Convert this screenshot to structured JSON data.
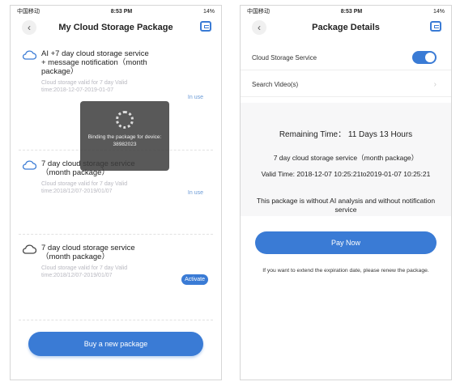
{
  "status_bar": {
    "carrier": "中国移动",
    "time": "8:53 PM",
    "battery": "14%"
  },
  "left": {
    "title": "My Cloud Storage Package",
    "packages": [
      {
        "title": "AI +7 day cloud storage service + message notification（month package）",
        "sub": "Cloud storage valid for 7 day Valid time:2018-12-07-2019-01-07",
        "status": "In use"
      },
      {
        "title": "7 day cloud storage service（month package）",
        "sub": "Cloud storage valid for 7 day Valid time:2018/12/07-2019/01/07",
        "status": "In use"
      },
      {
        "title": "7 day cloud storage service（month package）",
        "sub": "Cloud storage valid for 7 day Valid time:2018/12/07-2019/01/07",
        "status": "Activate"
      }
    ],
    "toast": "Binding the package for device: 38982023",
    "buy_button": "Buy a new package"
  },
  "right": {
    "title": "Package Details",
    "cloud_storage_service": "Cloud Storage Service",
    "cloud_storage_on": true,
    "search_videos": "Search Video(s)",
    "remaining_label": "Remaining Time：",
    "remaining_value": "11 Days 13 Hours",
    "package_name": "7 day cloud storage service（month package）",
    "valid_time": "Valid Time: 2018-12-07 10:25:21to2019-01-07 10:25:21",
    "note": "This package is without AI analysis and without notification service",
    "pay_button": "Pay Now",
    "footer": "If you want to extend the expiration date, please renew the package."
  },
  "colors": {
    "accent": "#3a7bd5"
  },
  "icons": {
    "back": "back-arrow-icon",
    "corner": "exit-icon",
    "package": "cloud-icon"
  }
}
